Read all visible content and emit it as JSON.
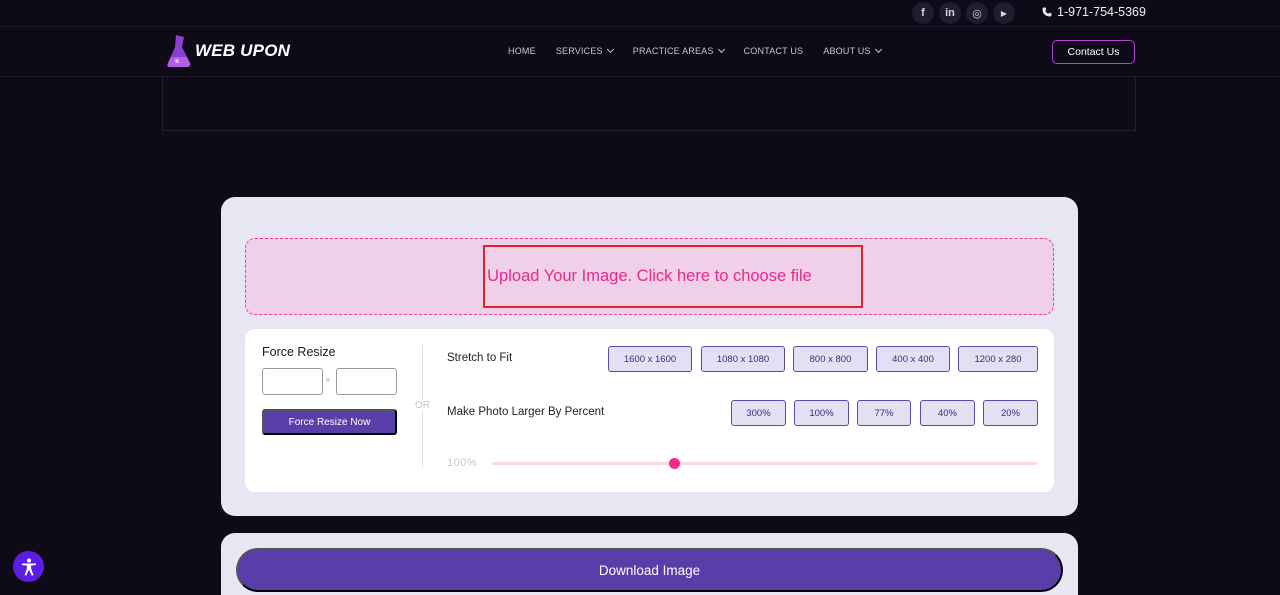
{
  "topbar": {
    "socials": [
      {
        "icon": "facebook-icon",
        "glyph": "f"
      },
      {
        "icon": "linkedin-icon",
        "glyph": "in"
      },
      {
        "icon": "instagram-icon",
        "glyph": "◎"
      },
      {
        "icon": "youtube-icon",
        "glyph": "▶"
      }
    ],
    "phone": "1-971-754-5369"
  },
  "nav": {
    "logo_text": "WEB UPON",
    "menu": [
      {
        "label": "HOME",
        "dropdown": false
      },
      {
        "label": "SERVICES",
        "dropdown": true
      },
      {
        "label": "PRACTICE AREAS",
        "dropdown": true
      },
      {
        "label": "CONTACT US",
        "dropdown": false
      },
      {
        "label": "ABOUT US",
        "dropdown": true
      }
    ],
    "contact_button": "Contact Us"
  },
  "tool": {
    "upload_text": "Upload Your Image. Click here to choose file",
    "force_resize_title": "Force Resize",
    "times_symbol": "×",
    "force_resize_button": "Force Resize Now",
    "or_text": "OR",
    "stretch_label": "Stretch to Fit",
    "stretch_sizes": [
      "1600 x 1600",
      "1080 x 1080",
      "800 x 800",
      "400 x 400",
      "1200 x 280"
    ],
    "larger_label": "Make Photo Larger By Percent",
    "percents": [
      "300%",
      "100%",
      "77%",
      "40%",
      "20%"
    ],
    "slider_value_label": "100%",
    "slider_fraction": 0.335
  },
  "download": {
    "button": "Download Image"
  },
  "colors": {
    "accent_purple": "#593da8",
    "pink": "#e8288a",
    "highlight_red": "#e0242c"
  }
}
